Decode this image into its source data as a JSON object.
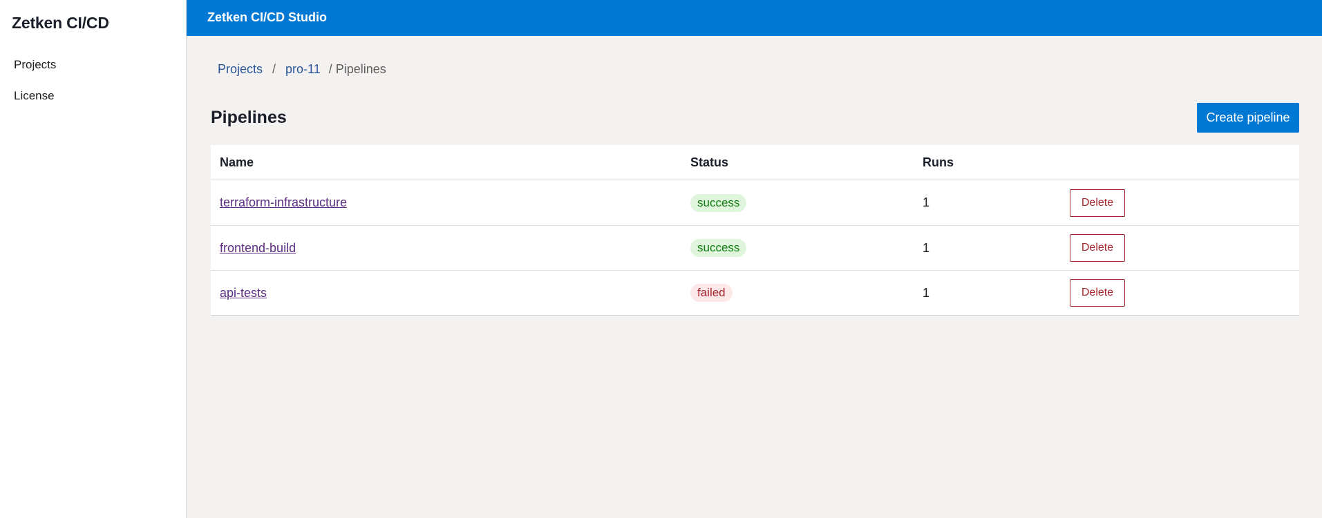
{
  "app": {
    "brand": "Zetken CI/CD",
    "topbar_title": "Zetken CI/CD Studio"
  },
  "sidebar": {
    "items": [
      {
        "label": "Projects"
      },
      {
        "label": "License"
      }
    ]
  },
  "breadcrumb": {
    "items": [
      {
        "label": "Projects"
      },
      {
        "label": "pro-11"
      }
    ],
    "separator": "/",
    "current": "/ Pipelines"
  },
  "page": {
    "title": "Pipelines",
    "create_label": "Create pipeline"
  },
  "table": {
    "columns": [
      "Name",
      "Status",
      "Runs",
      ""
    ],
    "rows": [
      {
        "name": "terraform-infrastructure",
        "status": "success",
        "runs": "1",
        "action": "Delete"
      },
      {
        "name": "frontend-build",
        "status": "success",
        "runs": "1",
        "action": "Delete"
      },
      {
        "name": "api-tests",
        "status": "failed",
        "runs": "1",
        "action": "Delete"
      }
    ]
  },
  "colors": {
    "accent": "#0078d4",
    "success_bg": "#dff6dd",
    "success_text": "#107c10",
    "failed_bg": "#fde7e9",
    "failed_text": "#a4262c",
    "link": "#5c2d82"
  }
}
